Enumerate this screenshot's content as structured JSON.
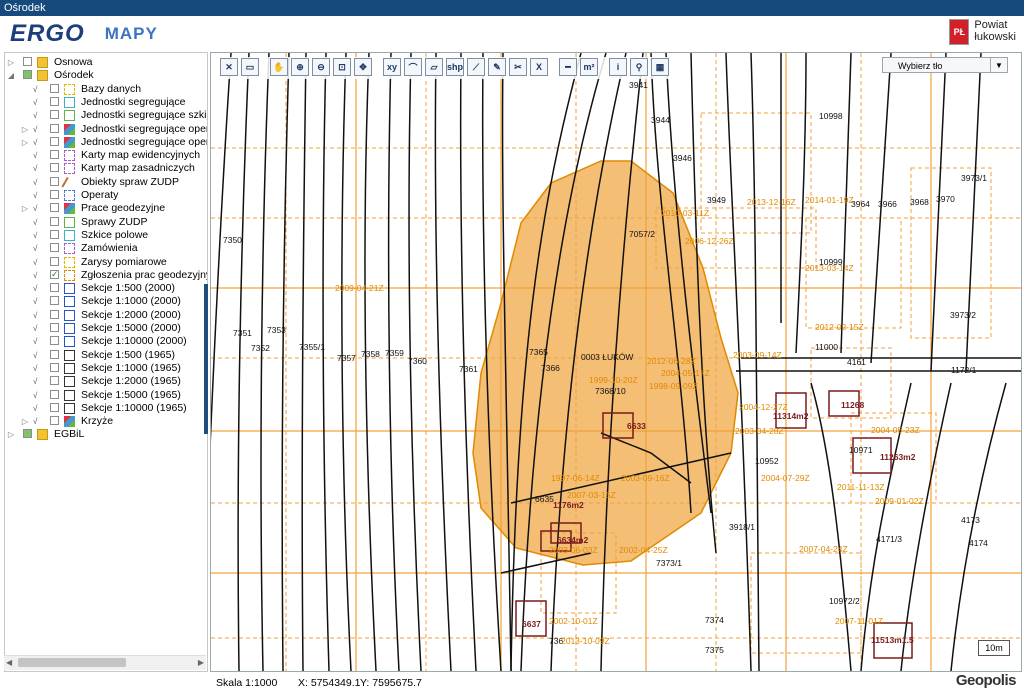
{
  "window": {
    "title": "Ośrodek"
  },
  "header": {
    "logo_main": "ERGO",
    "logo_sub": "MAPY",
    "crest_text": "PŁ",
    "powiat_line1": "Powiat",
    "powiat_line2": "łukowski"
  },
  "tree": [
    {
      "label": "Osnowa",
      "indent": 0,
      "icon": "folder",
      "expander": "▷",
      "checked": false,
      "green": false
    },
    {
      "label": "Ośrodek",
      "indent": 0,
      "icon": "folder",
      "expander": "◢",
      "checked": false,
      "green": true
    },
    {
      "label": "Bazy danych",
      "indent": 1,
      "icon": "dash-y",
      "checked": false
    },
    {
      "label": "Jednostki segregujące",
      "indent": 1,
      "icon": "dash-c",
      "checked": false
    },
    {
      "label": "Jednostki segregujące szkiców",
      "indent": 1,
      "icon": "dash-g",
      "checked": false
    },
    {
      "label": "Jednostki segregujące operatów",
      "indent": 1,
      "icon": "multi",
      "expander": "▷",
      "checked": false
    },
    {
      "label": "Jednostki segregujące operatów",
      "indent": 1,
      "icon": "multi",
      "expander": "▷",
      "checked": false
    },
    {
      "label": "Karty map ewidencyjnych",
      "indent": 1,
      "icon": "dash-p",
      "checked": false
    },
    {
      "label": "Karty map zasadniczych",
      "indent": 1,
      "icon": "dash-p",
      "checked": false
    },
    {
      "label": "Obiekty spraw ZUDP",
      "indent": 1,
      "icon": "pen",
      "checked": false
    },
    {
      "label": "Operaty",
      "indent": 1,
      "icon": "dash-b",
      "checked": false
    },
    {
      "label": "Prace geodezyjne",
      "indent": 1,
      "icon": "multi",
      "expander": "▷",
      "checked": false
    },
    {
      "label": "Sprawy ZUDP",
      "indent": 1,
      "icon": "dash-g",
      "checked": false
    },
    {
      "label": "Szkice polowe",
      "indent": 1,
      "icon": "dash-c",
      "checked": false
    },
    {
      "label": "Zamówienia",
      "indent": 1,
      "icon": "dash-p",
      "checked": false
    },
    {
      "label": "Zarysy pomiarowe",
      "indent": 1,
      "icon": "dash-y",
      "checked": false
    },
    {
      "label": "Zgłoszenia prac geodezyjnych",
      "indent": 1,
      "icon": "sq-o",
      "checked": true
    },
    {
      "label": "Sekcje 1:500 (2000)",
      "indent": 1,
      "icon": "sq-b",
      "checked": false
    },
    {
      "label": "Sekcje 1:1000 (2000)",
      "indent": 1,
      "icon": "sq-b",
      "checked": false
    },
    {
      "label": "Sekcje 1:2000 (2000)",
      "indent": 1,
      "icon": "sq-b",
      "checked": false
    },
    {
      "label": "Sekcje 1:5000 (2000)",
      "indent": 1,
      "icon": "sq-b",
      "checked": false
    },
    {
      "label": "Sekcje 1:10000 (2000)",
      "indent": 1,
      "icon": "sq-b",
      "checked": false
    },
    {
      "label": "Sekcje 1:500 (1965)",
      "indent": 1,
      "icon": "sq-k",
      "checked": false
    },
    {
      "label": "Sekcje 1:1000 (1965)",
      "indent": 1,
      "icon": "sq-k",
      "checked": false
    },
    {
      "label": "Sekcje 1:2000 (1965)",
      "indent": 1,
      "icon": "sq-k",
      "checked": false
    },
    {
      "label": "Sekcje 1:5000 (1965)",
      "indent": 1,
      "icon": "sq-k",
      "checked": false
    },
    {
      "label": "Sekcje 1:10000 (1965)",
      "indent": 1,
      "icon": "sq-k",
      "checked": false
    },
    {
      "label": "Krzyże",
      "indent": 1,
      "icon": "multi",
      "expander": "▷",
      "checked": false
    },
    {
      "label": "EGBiL",
      "indent": 0,
      "icon": "folder",
      "expander": "▷",
      "checked": false,
      "green": true
    }
  ],
  "toolbar": [
    {
      "name": "close-tool",
      "glyph": "✕"
    },
    {
      "name": "save-tool",
      "glyph": "▭"
    },
    {
      "name": "pan-tool",
      "glyph": "✋",
      "gap": true
    },
    {
      "name": "zoom-in-tool",
      "glyph": "⊕"
    },
    {
      "name": "zoom-out-tool",
      "glyph": "⊖"
    },
    {
      "name": "zoom-window-tool",
      "glyph": "⊡"
    },
    {
      "name": "zoom-extent-tool",
      "glyph": "✥"
    },
    {
      "name": "coordinates-tool",
      "glyph": "xy",
      "gap": true
    },
    {
      "name": "polyline-tool",
      "glyph": "⌒"
    },
    {
      "name": "polygon-tool",
      "glyph": "▱"
    },
    {
      "name": "shp-tool",
      "glyph": "shp"
    },
    {
      "name": "line-tool",
      "glyph": "⟋"
    },
    {
      "name": "edit-tool",
      "glyph": "✎"
    },
    {
      "name": "cut-tool",
      "glyph": "✂"
    },
    {
      "name": "delete-tool",
      "glyph": "X"
    },
    {
      "name": "measure-length-tool",
      "glyph": "━",
      "gap": true
    },
    {
      "name": "measure-area-tool",
      "glyph": "m²"
    },
    {
      "name": "info-tool",
      "glyph": "i",
      "gap": true
    },
    {
      "name": "pin-tool",
      "glyph": "⚲"
    },
    {
      "name": "raster-tool",
      "glyph": "▦"
    }
  ],
  "background_select": {
    "label": "Wybierz tło"
  },
  "map": {
    "parcel_labels": [
      "3941",
      "3944",
      "3946",
      "3949",
      "10998",
      "3964",
      "3966",
      "3968",
      "3970",
      "3973/1",
      "7350",
      "7351",
      "7352",
      "7353",
      "7355/1",
      "7357",
      "7358",
      "7359",
      "7360",
      "7361",
      "7365",
      "7366",
      "7368/10",
      "0003 ŁUKÓW",
      "7057/2",
      "10999",
      "3973/2",
      "11000",
      "4161",
      "1172/1",
      "10952",
      "10971",
      "3918/1",
      "4173",
      "4171/3",
      "4174",
      "7373/1",
      "7374",
      "7375",
      "10972/2",
      "6635",
      "736"
    ],
    "dated_labels": [
      "2010-03-11Z",
      "2013-12-16Z",
      "2014-01-19Z",
      "2006-12-26Z",
      "2013-03-14Z",
      "2009-04-21Z",
      "2012-02-15Z",
      "2003-09-14Z",
      "2012-06-28Z",
      "2004-05-17Z",
      "1999-10-20Z",
      "1998-09-09Z",
      "2004-12-27Z",
      "2003-04-28Z",
      "2004-05-23Z",
      "1997-06-14Z",
      "2003-09-16Z",
      "2007-03-15Z",
      "2004-07-29Z",
      "2011-11-13Z",
      "2009-01-02Z",
      "2002-04-25Z",
      "2003-06-03Z",
      "2007-04-24Z",
      "2002-10-01Z",
      "2013-10-09Z",
      "2007-11-01Z"
    ],
    "building_labels": [
      "6633",
      "11314m2",
      "11268",
      "11263m2",
      "1176m2",
      "6634m2",
      "6637",
      "11513m1.5"
    ],
    "scale_label": "10m"
  },
  "status": {
    "scale": "Skala 1:1000",
    "x": "X: 5754349.1",
    "y": "Y: 7595675.7",
    "brand": "Geopolis"
  },
  "colors": {
    "titlebar": "#174a7c",
    "zone_fill": "#f0a33a",
    "orange_line": "#f39c12"
  }
}
